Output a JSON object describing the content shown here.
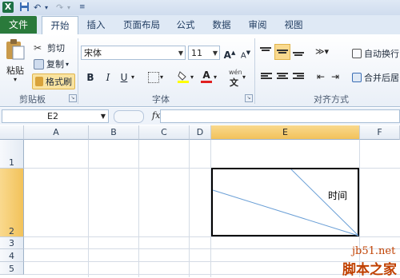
{
  "tabs": {
    "file": "文件",
    "home": "开始",
    "insert": "插入",
    "page_layout": "页面布局",
    "formulas": "公式",
    "data": "数据",
    "review": "审阅",
    "view": "视图"
  },
  "clipboard": {
    "paste": "粘贴",
    "cut": "剪切",
    "copy": "复制",
    "format_painter": "格式刷",
    "group_label": "剪贴板"
  },
  "font": {
    "name": "宋体",
    "size": "11",
    "bold": "B",
    "italic": "I",
    "underline": "U",
    "font_color_letter": "A",
    "grow": "A",
    "shrink": "A",
    "group_label": "字体",
    "phonetic": "wén"
  },
  "alignment": {
    "wrap_text": "自动换行",
    "merge_center": "合并后居",
    "group_label": "对齐方式"
  },
  "formula_bar": {
    "name_box": "E2",
    "fx": "fx"
  },
  "sheet": {
    "columns": [
      "A",
      "B",
      "C",
      "D",
      "E",
      "F"
    ],
    "rows": [
      "1",
      "2",
      "3",
      "4",
      "5"
    ],
    "cell_e2_text": "时间"
  },
  "watermark": {
    "site": "jb51.net",
    "brand": "脚本之家"
  },
  "colors": {
    "file_tab": "#2a7a3b",
    "selected_header": "#f2c25a",
    "diagonal_line": "#6a9fd6",
    "font_color_bar": "#e02020",
    "highlight_bar": "#ffff00"
  }
}
